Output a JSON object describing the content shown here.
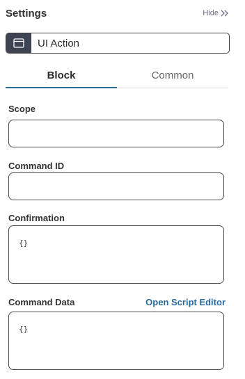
{
  "header": {
    "title": "Settings",
    "hide_label": "Hide"
  },
  "component": {
    "name": "UI Action",
    "icon": "window-icon"
  },
  "tabs": [
    {
      "label": "Block",
      "active": true
    },
    {
      "label": "Common",
      "active": false
    }
  ],
  "fields": {
    "scope": {
      "label": "Scope",
      "value": ""
    },
    "command_id": {
      "label": "Command ID",
      "value": ""
    },
    "confirmation": {
      "label": "Confirmation",
      "value": "{}"
    },
    "command_data": {
      "label": "Command Data",
      "value": "{}",
      "link_label": "Open Script Editor"
    }
  },
  "colors": {
    "accent": "#2a6a9a",
    "icon_bg": "#3d4352"
  }
}
